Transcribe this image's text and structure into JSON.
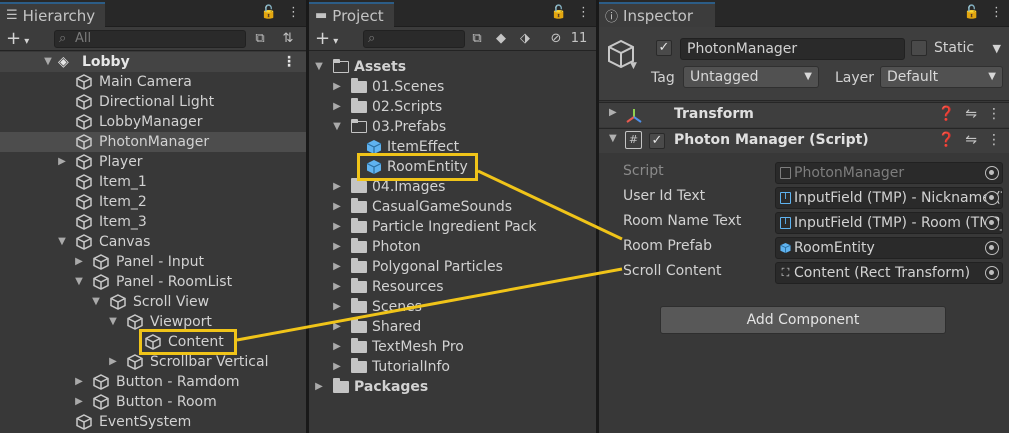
{
  "hierarchy": {
    "tab_title": "Hierarchy",
    "search_placeholder": "All",
    "scene_name": "Lobby",
    "items": [
      {
        "label": "Main Camera"
      },
      {
        "label": "Directional Light"
      },
      {
        "label": "LobbyManager"
      },
      {
        "label": "PhotonManager",
        "selected": true
      },
      {
        "label": "Player"
      },
      {
        "label": "Item_1"
      },
      {
        "label": "Item_2"
      },
      {
        "label": "Item_3"
      },
      {
        "label": "Canvas"
      },
      {
        "label": "Panel - Input"
      },
      {
        "label": "Panel - RoomList"
      },
      {
        "label": "Scroll View"
      },
      {
        "label": "Viewport"
      },
      {
        "label": "Content"
      },
      {
        "label": "Scrollbar Vertical"
      },
      {
        "label": "Button - Ramdom"
      },
      {
        "label": "Button - Room"
      },
      {
        "label": "EventSystem"
      }
    ]
  },
  "project": {
    "tab_title": "Project",
    "hidden_count": "11",
    "items": [
      {
        "label": "Assets"
      },
      {
        "label": "01.Scenes"
      },
      {
        "label": "02.Scripts"
      },
      {
        "label": "03.Prefabs"
      },
      {
        "label": "ItemEffect"
      },
      {
        "label": "RoomEntity"
      },
      {
        "label": "04.Images"
      },
      {
        "label": "CasualGameSounds"
      },
      {
        "label": "Particle Ingredient Pack"
      },
      {
        "label": "Photon"
      },
      {
        "label": "Polygonal Particles"
      },
      {
        "label": "Resources"
      },
      {
        "label": "Scenes"
      },
      {
        "label": "Shared"
      },
      {
        "label": "TextMesh Pro"
      },
      {
        "label": "TutorialInfo"
      },
      {
        "label": "Packages"
      }
    ]
  },
  "inspector": {
    "tab_title": "Inspector",
    "object_name": "PhotonManager",
    "active": true,
    "static_label": "Static",
    "tag_label": "Tag",
    "tag_value": "Untagged",
    "layer_label": "Layer",
    "layer_value": "Default",
    "transform_title": "Transform",
    "component_title": "Photon Manager (Script)",
    "properties": [
      {
        "label": "Script",
        "value": "PhotonManager"
      },
      {
        "label": "User Id Text",
        "value": "InputField (TMP) - Nickname (TMP_InputField)"
      },
      {
        "label": "Room Name Text",
        "value": "InputField (TMP) - Room (TMP_InputField)"
      },
      {
        "label": "Room Prefab",
        "value": "RoomEntity"
      },
      {
        "label": "Scroll Content",
        "value": "Content (Rect Transform)"
      }
    ],
    "add_component_label": "Add Component"
  },
  "colors": {
    "highlight": "#f0c419",
    "panel_bg": "#383838",
    "selection_bg": "#4d4d4d",
    "prefab_blue": "#5fb3f0"
  }
}
